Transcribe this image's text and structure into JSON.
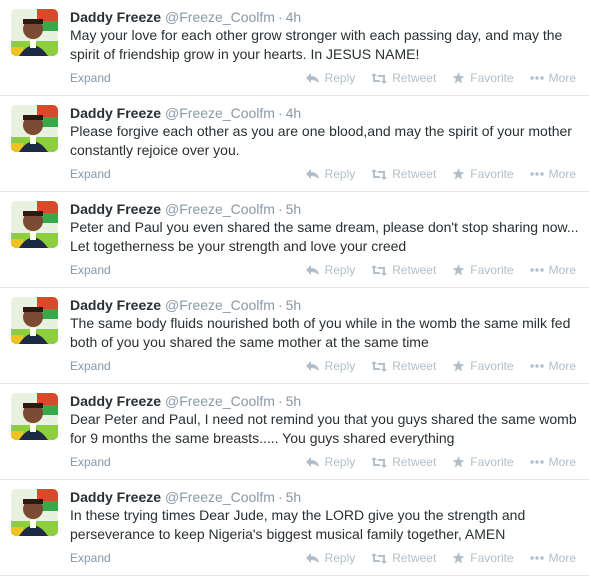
{
  "actions": {
    "expand": "Expand",
    "reply": "Reply",
    "retweet": "Retweet",
    "favorite": "Favorite",
    "more": "More"
  },
  "tweets": [
    {
      "name": "Daddy Freeze",
      "handle": "@Freeze_Coolfm",
      "sep": "·",
      "time": "4h",
      "text": "May your love for each other grow stronger with each passing day, and may the spirit of friendship grow in your hearts. In JESUS NAME!"
    },
    {
      "name": "Daddy Freeze",
      "handle": "@Freeze_Coolfm",
      "sep": "·",
      "time": "4h",
      "text": "Please forgive each other as you are one blood,and may the spirit of your mother constantly rejoice over you."
    },
    {
      "name": "Daddy Freeze",
      "handle": "@Freeze_Coolfm",
      "sep": "·",
      "time": "5h",
      "text": "Peter and Paul you even shared the same dream, please don't stop sharing now... Let togetherness be your strength and love your creed"
    },
    {
      "name": "Daddy Freeze",
      "handle": "@Freeze_Coolfm",
      "sep": "·",
      "time": "5h",
      "text": "The same body fluids nourished both of you while in the womb the same milk fed both of you you shared the same mother at the same time"
    },
    {
      "name": "Daddy Freeze",
      "handle": "@Freeze_Coolfm",
      "sep": "·",
      "time": "5h",
      "text": "Dear Peter and Paul, I need not remind you that you guys shared the same womb for 9 months the same breasts..... You guys shared everything"
    },
    {
      "name": "Daddy Freeze",
      "handle": "@Freeze_Coolfm",
      "sep": "·",
      "time": "5h",
      "text": "In these trying times Dear Jude, may the LORD give you the strength and perseverance to keep Nigeria's biggest musical family together, AMEN"
    }
  ]
}
